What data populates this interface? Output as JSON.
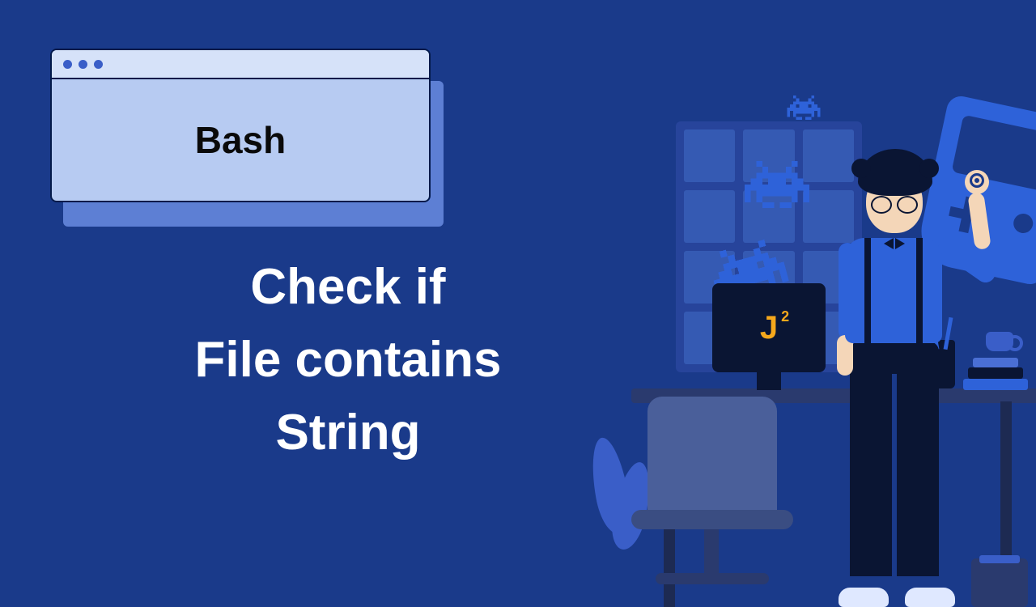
{
  "card": {
    "title": "Bash"
  },
  "caption": {
    "line1": "Check if",
    "line2": "File contains",
    "line3": "String"
  },
  "monitor": {
    "logo": "J",
    "sup": "2"
  }
}
